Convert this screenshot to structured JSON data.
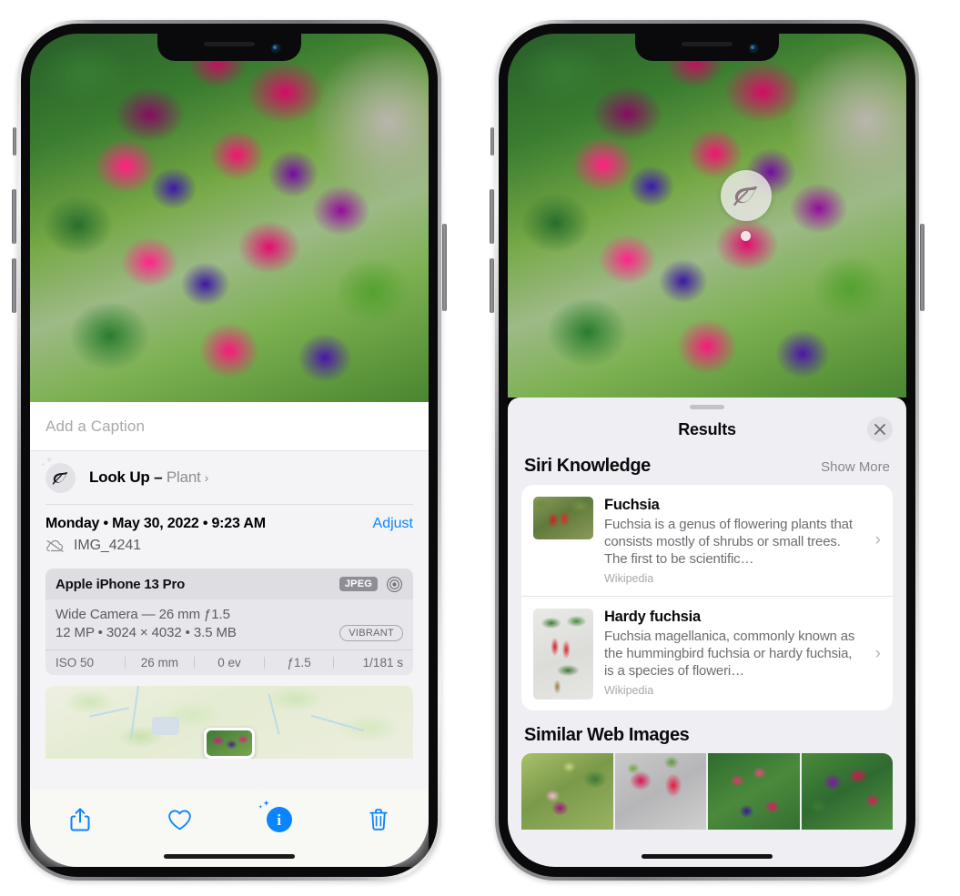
{
  "left_phone": {
    "name": "photos-detail-view",
    "photo": {
      "alt": "fuchsia-flowers-photo"
    },
    "caption": {
      "placeholder": "Add a Caption",
      "value": ""
    },
    "look_up": {
      "icon": "leaf-icon",
      "label": "Look Up –",
      "subject": "Plant",
      "chevron": "›"
    },
    "metadata": {
      "date": "Monday • May 30, 2022 • 9:23 AM",
      "adjust_label": "Adjust",
      "cloud_icon": "cloud-slash-icon",
      "filename": "IMG_4241"
    },
    "camera_card": {
      "model": "Apple iPhone 13 Pro",
      "format_badge": "JPEG",
      "aperture_icon": "aperture-icon",
      "lens": "Wide Camera — 26 mm ƒ1.5",
      "size": "12 MP • 3024 × 4032 • 3.5 MB",
      "style_badge": "VIBRANT",
      "exif": [
        "ISO 50",
        "26 mm",
        "0 ev",
        "ƒ1.5",
        "1/181 s"
      ]
    },
    "map": {
      "alt": "location-map-thumbnail",
      "pin": "photo-pin"
    },
    "toolbar": [
      {
        "name": "share-button",
        "icon": "share-icon"
      },
      {
        "name": "favorite-button",
        "icon": "heart-icon"
      },
      {
        "name": "info-button",
        "icon": "info-sparkle-icon"
      },
      {
        "name": "delete-button",
        "icon": "trash-icon"
      }
    ]
  },
  "right_phone": {
    "name": "visual-look-up-results",
    "badge": {
      "icon": "leaf-icon",
      "label": "visual-look-up-badge"
    },
    "sheet": {
      "grabber": "sheet-grabber",
      "title": "Results",
      "close_icon": "close-icon"
    },
    "siri_knowledge": {
      "title": "Siri Knowledge",
      "show_more": "Show More",
      "items": [
        {
          "thumb": "fuchsia-thumbnail",
          "title": "Fuchsia",
          "desc": "Fuchsia is a genus of flowering plants that consists mostly of shrubs or small trees. The first to be scientific…",
          "source": "Wikipedia",
          "chevron": "›"
        },
        {
          "thumb": "hardy-fuchsia-thumbnail",
          "title": "Hardy fuchsia",
          "desc": "Fuchsia magellanica, commonly known as the hummingbird fuchsia or hardy fuchsia, is a species of floweri…",
          "source": "Wikipedia",
          "chevron": "›"
        }
      ]
    },
    "similar_web_images": {
      "title": "Similar Web Images",
      "tiles": [
        "fuchsia-web-image-1",
        "fuchsia-web-image-2",
        "fuchsia-web-image-3",
        "fuchsia-web-image-4"
      ]
    }
  },
  "colors": {
    "accent_blue": "#0a84ff",
    "sheet_bg": "#eeeef3",
    "card_bg": "#ffffff",
    "info_bg": "#f4f4f7",
    "secondary_text": "#6d6d73"
  }
}
